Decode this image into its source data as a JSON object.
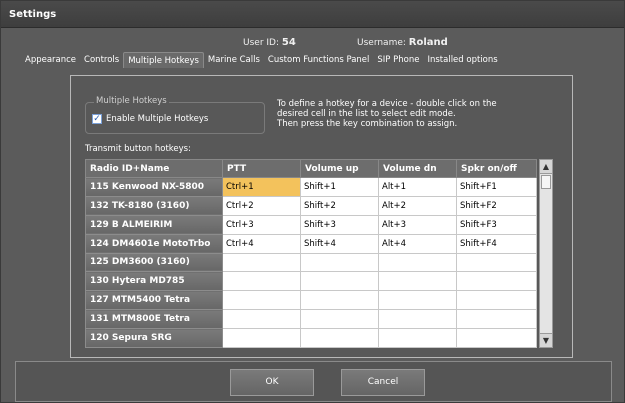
{
  "window": {
    "title": "Settings"
  },
  "user": {
    "id_label": "User ID:",
    "id_value": "54",
    "name_label": "Username:",
    "name_value": "Roland"
  },
  "tabs": [
    {
      "label": "Appearance",
      "active": false
    },
    {
      "label": "Controls",
      "active": false
    },
    {
      "label": "Multiple Hotkeys",
      "active": true
    },
    {
      "label": "Marine Calls",
      "active": false
    },
    {
      "label": "Custom Functions Panel",
      "active": false
    },
    {
      "label": "SIP Phone",
      "active": false
    },
    {
      "label": "Installed options",
      "active": false
    }
  ],
  "group": {
    "legend": "Multiple Hotkeys",
    "checkbox_label": "Enable Multiple Hotkeys",
    "checked": true
  },
  "help_lines": [
    "To define a hotkey for a device - double click on the",
    "desired cell in the list to select edit mode.",
    "Then press the key combination to assign."
  ],
  "table_caption": "Transmit button hotkeys:",
  "table": {
    "columns": [
      "Radio ID+Name",
      "PTT",
      "Volume up",
      "Volume dn",
      "Spkr on/off"
    ],
    "rows": [
      [
        "115  Kenwood NX-5800",
        "Ctrl+1",
        "Shift+1",
        "Alt+1",
        "Shift+F1"
      ],
      [
        "132  TK-8180 (3160)",
        "Ctrl+2",
        "Shift+2",
        "Alt+2",
        "Shift+F2"
      ],
      [
        "129  B ALMEIRIM",
        "Ctrl+3",
        "Shift+3",
        "Alt+3",
        "Shift+F3"
      ],
      [
        "124  DM4601e  MotoTrbo",
        "Ctrl+4",
        "Shift+4",
        "Alt+4",
        "Shift+F4"
      ],
      [
        "125  DM3600 (3160)",
        "",
        "",
        "",
        ""
      ],
      [
        "130  Hytera MD785",
        "",
        "",
        "",
        ""
      ],
      [
        "127  MTM5400 Tetra",
        "",
        "",
        "",
        ""
      ],
      [
        "131  MTM800E  Tetra",
        "",
        "",
        "",
        ""
      ],
      [
        "120  Sepura SRG",
        "",
        "",
        "",
        ""
      ]
    ],
    "selected_cell": {
      "row": 0,
      "col": 1
    }
  },
  "buttons": {
    "ok": "OK",
    "cancel": "Cancel"
  },
  "colors": {
    "selected_cell": "#f3c25c",
    "row_header": "#6d6d6d"
  }
}
